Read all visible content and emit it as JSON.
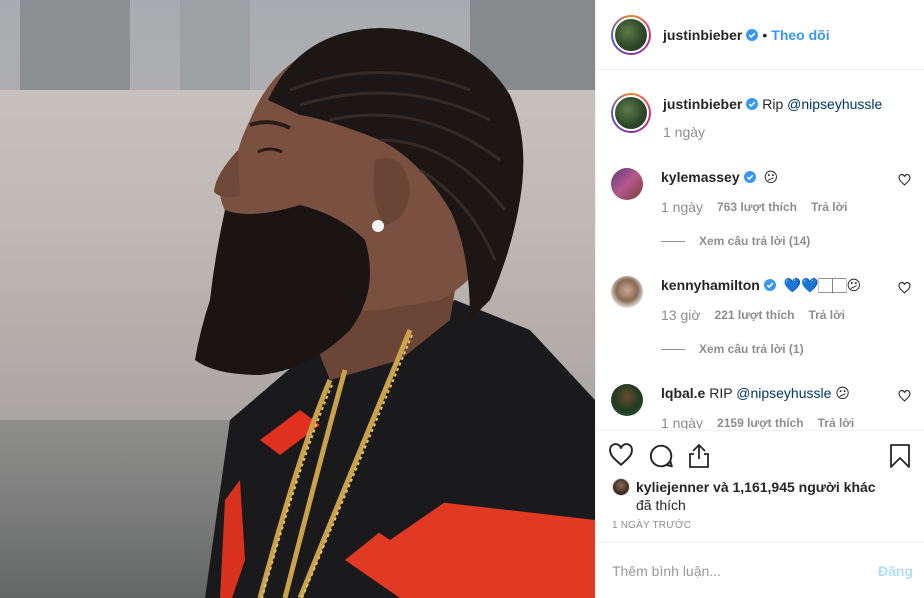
{
  "header": {
    "username": "justinbieber",
    "separator": "•",
    "follow_label": "Theo dõi"
  },
  "caption": {
    "username": "justinbieber",
    "text": "Rip",
    "mention": "@nipseyhussle",
    "time": "1 ngày"
  },
  "comments": [
    {
      "username": "kylemassey",
      "verified": true,
      "text": "😕",
      "time": "1 ngày",
      "likes": "763 lượt thích",
      "reply": "Trả lời",
      "view_replies": "Xem câu trả lời (14)"
    },
    {
      "username": "kennyhamilton",
      "verified": true,
      "text": "💙💙🏻🏻😕",
      "time": "13 giờ",
      "likes": "221 lượt thích",
      "reply": "Trả lời",
      "view_replies": "Xem câu trả lời (1)"
    },
    {
      "username": "lqbal.e",
      "verified": false,
      "text": "RIP",
      "mention": "@nipseyhussle",
      "emoji": "😕",
      "time": "1 ngày",
      "likes": "2159 lượt thích",
      "reply": "Trả lời"
    }
  ],
  "likes": {
    "user": "kyliejenner",
    "text": "và 1,161,945 người khác",
    "line2": "đã thích"
  },
  "posted": "1 NGÀY TRƯỚC",
  "add_comment": {
    "placeholder": "Thêm bình luận...",
    "post_label": "Đăng"
  },
  "colors": {
    "accent": "#3897f0",
    "verified": "#3897f0",
    "muted": "#8e8e8e"
  },
  "icons": [
    "verified-badge-icon",
    "heart-icon",
    "comment-icon",
    "share-icon",
    "bookmark-icon"
  ]
}
